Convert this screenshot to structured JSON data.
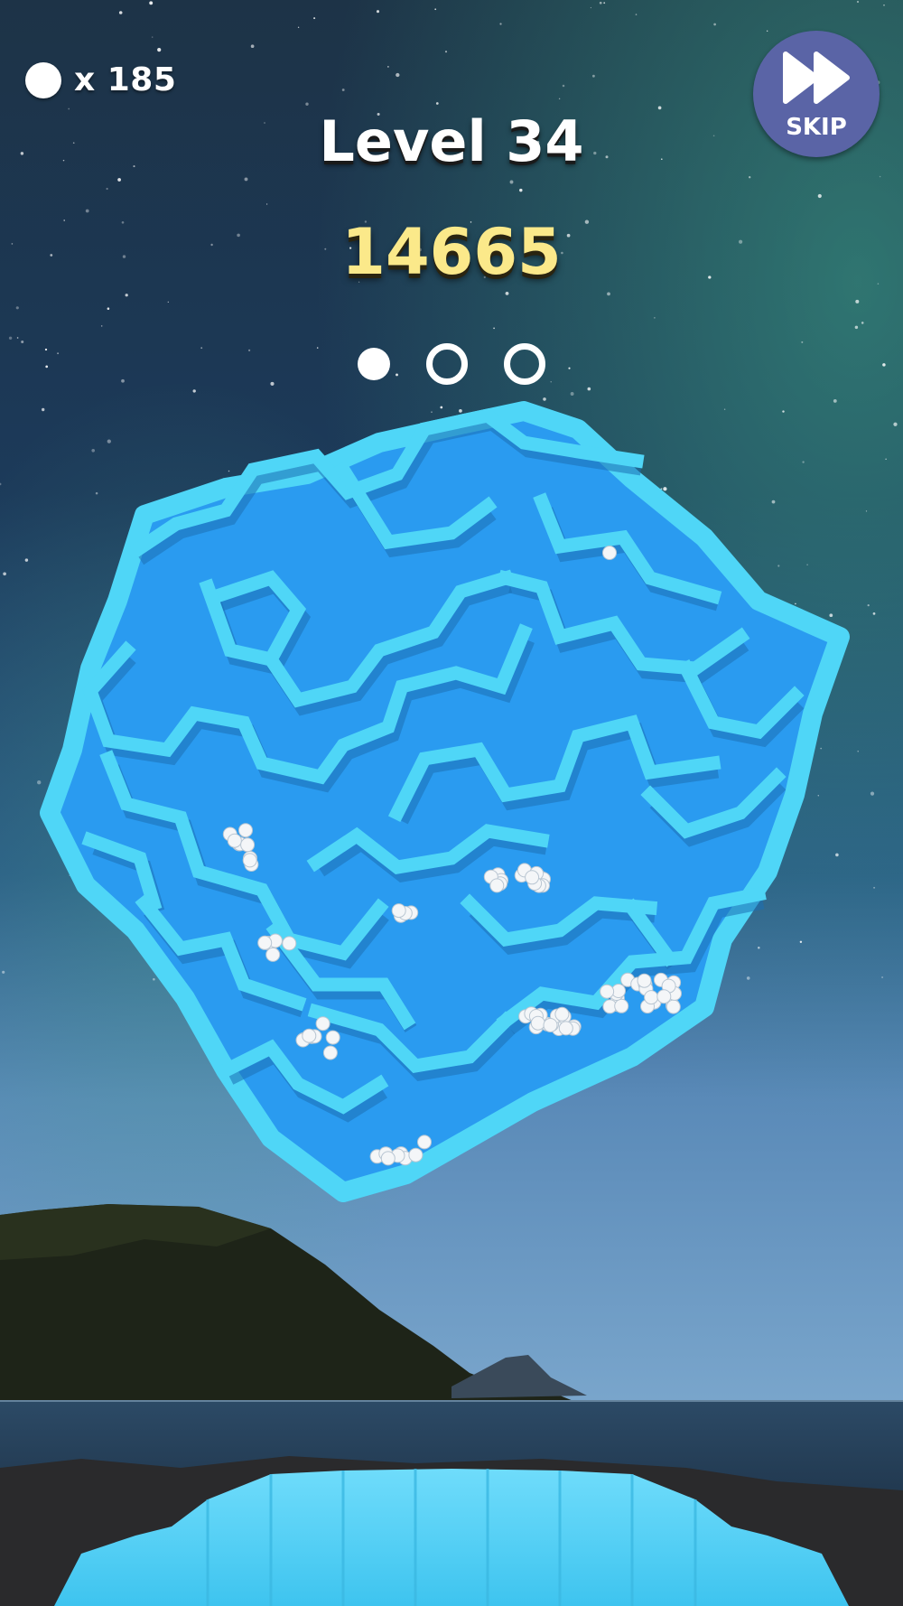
{
  "hud": {
    "ball_count": "x 185",
    "level_title": "Level 34",
    "score": "14665",
    "stage_progress": {
      "completed": 1,
      "total": 3
    },
    "skip_label": "SKIP"
  },
  "colors": {
    "maze_floor": "#2a9bf0",
    "maze_wall": "#4fd6f7",
    "score_text": "#fbe98a",
    "skip_button": "#5a64a6"
  },
  "icons": [
    "ball-icon",
    "fast-forward-icon"
  ]
}
